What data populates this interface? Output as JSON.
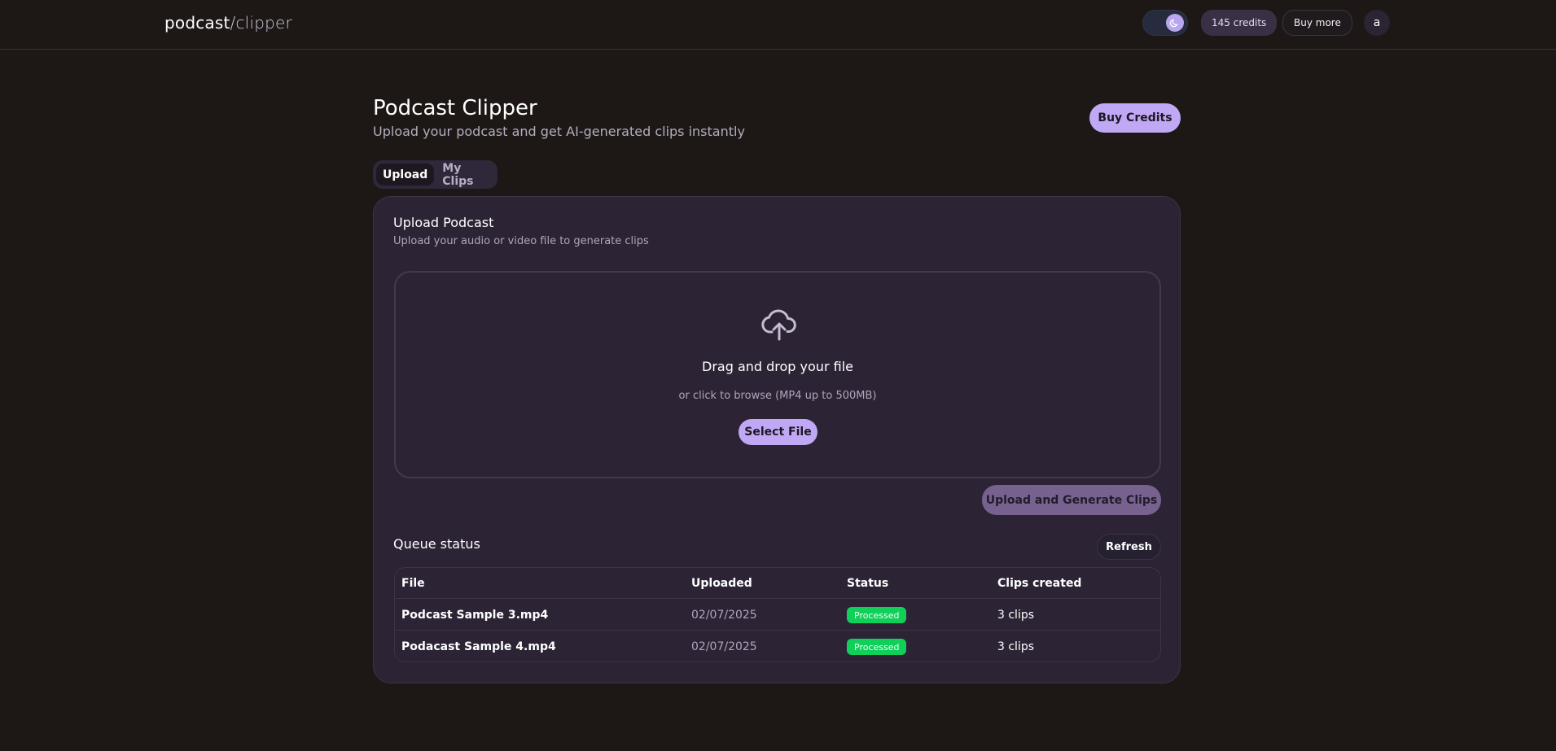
{
  "header": {
    "brand_primary": "podcast",
    "brand_secondary": "/clipper",
    "credits": "145 credits",
    "buy_more": "Buy more",
    "avatar_initial": "a"
  },
  "page": {
    "title": "Podcast Clipper",
    "subtitle": "Upload your podcast and get AI-generated clips instantly",
    "buy_credits": "Buy Credits"
  },
  "tabs": [
    {
      "label": "Upload",
      "active": true
    },
    {
      "label": "My Clips",
      "active": false
    }
  ],
  "upload_card": {
    "title": "Upload Podcast",
    "subtitle": "Upload your audio or video file to generate clips",
    "drop_title": "Drag and drop your file",
    "drop_hint": "or click to browse (MP4 up to 500MB)",
    "select_button": "Select File",
    "generate_button": "Upload and Generate Clips"
  },
  "queue": {
    "title": "Queue status",
    "refresh": "Refresh",
    "columns": [
      "File",
      "Uploaded",
      "Status",
      "Clips created"
    ],
    "rows": [
      {
        "file": "Podcast Sample 3.mp4",
        "uploaded": "02/07/2025",
        "status": "Processed",
        "clips": "3 clips"
      },
      {
        "file": "Podacast Sample 4.mp4",
        "uploaded": "02/07/2025",
        "status": "Processed",
        "clips": "3 clips"
      }
    ]
  },
  "colors": {
    "background": "#1d1816",
    "card": "#2c2435",
    "accent": "#c1a8f5",
    "status_processed": "#10d05a"
  },
  "icons": {
    "theme_toggle": "moon-icon",
    "dropzone": "cloud-upload-icon"
  }
}
